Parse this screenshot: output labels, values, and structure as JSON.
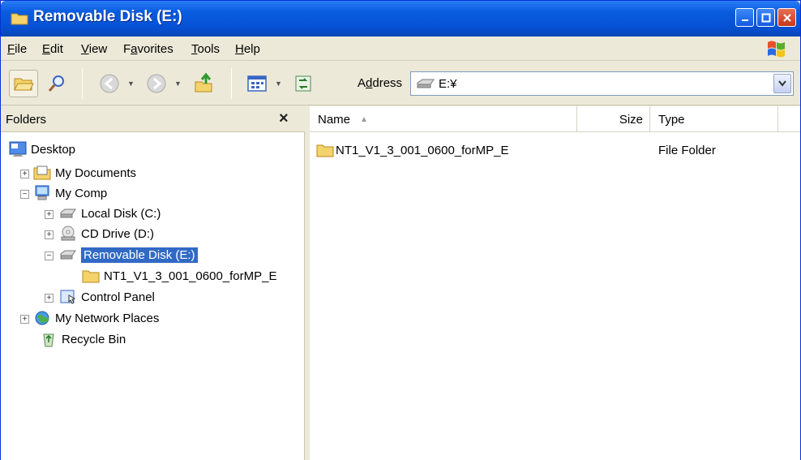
{
  "window": {
    "title": "Removable Disk (E:)"
  },
  "menu": [
    {
      "prefix": "",
      "accel": "F",
      "rest": "ile"
    },
    {
      "prefix": "",
      "accel": "E",
      "rest": "dit"
    },
    {
      "prefix": "",
      "accel": "V",
      "rest": "iew"
    },
    {
      "prefix": "F",
      "accel": "a",
      "rest": "vorites"
    },
    {
      "prefix": "",
      "accel": "T",
      "rest": "ools"
    },
    {
      "prefix": "",
      "accel": "H",
      "rest": "elp"
    }
  ],
  "address": {
    "label_pre": "A",
    "label_accel": "d",
    "label_post": "dress",
    "value": "E:¥"
  },
  "folders": {
    "title": "Folders",
    "close": "×",
    "tree": [
      {
        "label": "Desktop",
        "icon": "desktop-icon"
      },
      {
        "label": "My Documents",
        "icon": "my-documents-icon",
        "expander": "+"
      },
      {
        "label": "My Comp",
        "icon": "my-computer-icon",
        "expander": "−"
      },
      {
        "label": "Local Disk (C:)",
        "icon": "hard-drive-icon",
        "expander": "+"
      },
      {
        "label": "CD Drive (D:)",
        "icon": "cd-drive-icon",
        "expander": "+"
      },
      {
        "label": "Removable Disk (E:)",
        "icon": "removable-disk-icon",
        "expander": "−",
        "selected": true
      },
      {
        "label": "NT1_V1_3_001_0600_forMP_E",
        "icon": "folder-icon"
      },
      {
        "label": "Control Panel",
        "icon": "control-panel-icon",
        "expander": "+"
      },
      {
        "label": "My Network Places",
        "icon": "network-places-icon",
        "expander": "+"
      },
      {
        "label": "Recycle Bin",
        "icon": "recycle-bin-icon"
      }
    ]
  },
  "list": {
    "columns": {
      "name": "Name",
      "size": "Size",
      "type": "Type"
    },
    "rows": [
      {
        "name": "NT1_V1_3_001_0600_forMP_E",
        "size": "",
        "type": "File Folder"
      }
    ]
  },
  "colors": {
    "titlebar": "#0a5de0",
    "selection": "#316ac5",
    "chrome": "#ece9d8"
  }
}
